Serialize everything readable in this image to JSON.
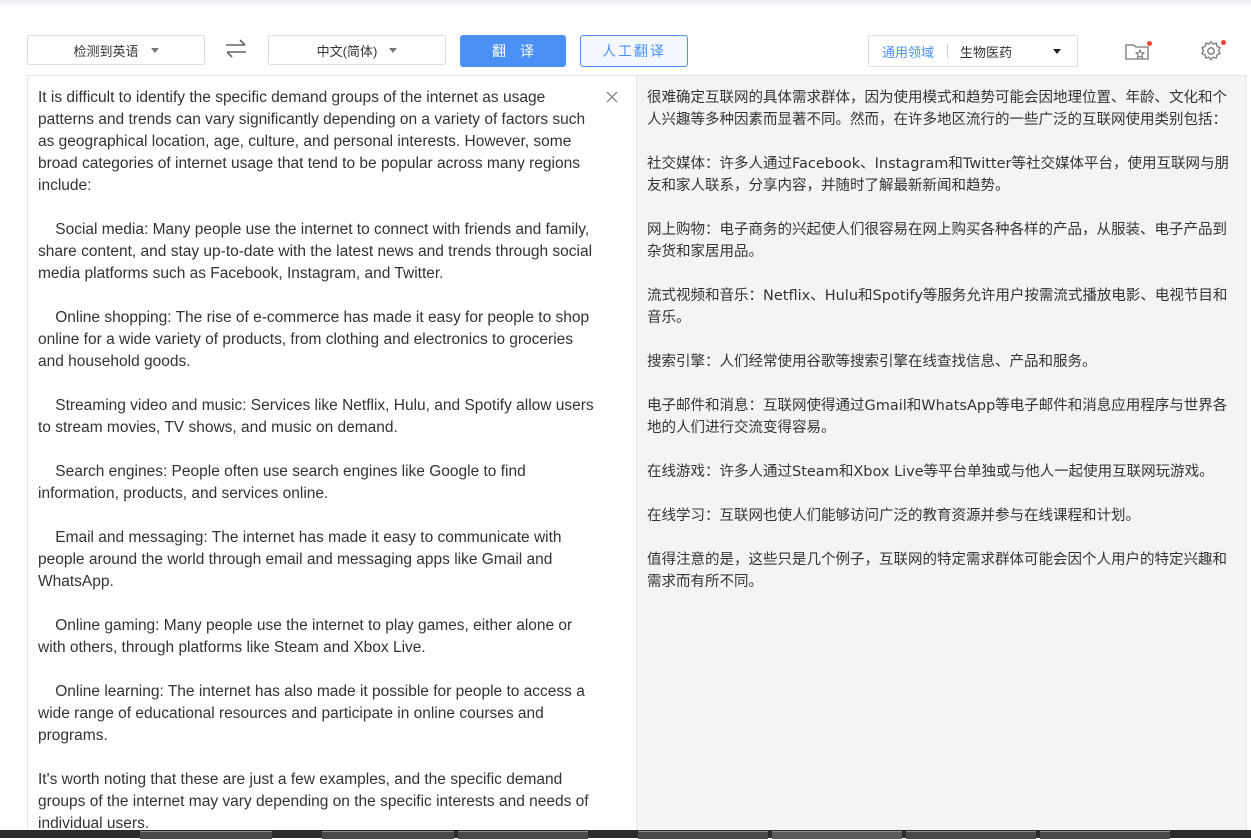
{
  "toolbar": {
    "source_language": "检测到英语",
    "target_language": "中文(简体)",
    "translate_label": "翻译",
    "human_translate_label": "人工翻译",
    "domain_general": "通用领域",
    "domain_current": "生物医药",
    "icons": {
      "swap": "swap-arrows-icon",
      "favorites": "folder-star-icon",
      "settings": "gear-icon",
      "clear": "close-icon"
    },
    "notification_color": "#f04134",
    "accent_color": "#4a90f5"
  },
  "source": {
    "text": "It is difficult to identify the specific demand groups of the internet as usage patterns and trends can vary significantly depending on a variety of factors such as geographical location, age, culture, and personal interests. However, some broad categories of internet usage that tend to be popular across many regions include:\n\n    Social media: Many people use the internet to connect with friends and family, share content, and stay up-to-date with the latest news and trends through social media platforms such as Facebook, Instagram, and Twitter.\n\n    Online shopping: The rise of e-commerce has made it easy for people to shop online for a wide variety of products, from clothing and electronics to groceries and household goods.\n\n    Streaming video and music: Services like Netflix, Hulu, and Spotify allow users to stream movies, TV shows, and music on demand.\n\n    Search engines: People often use search engines like Google to find information, products, and services online.\n\n    Email and messaging: The internet has made it easy to communicate with people around the world through email and messaging apps like Gmail and WhatsApp.\n\n    Online gaming: Many people use the internet to play games, either alone or with others, through platforms like Steam and Xbox Live.\n\n    Online learning: The internet has also made it possible for people to access a wide range of educational resources and participate in online courses and programs.\n\nIt's worth noting that these are just a few examples, and the specific demand groups of the internet may vary depending on the specific interests and needs of individual users."
  },
  "target": {
    "text": "很难确定互联网的具体需求群体，因为使用模式和趋势可能会因地理位置、年龄、文化和个人兴趣等多种因素而显著不同。然而，在许多地区流行的一些广泛的互联网使用类别包括：\n\n社交媒体：许多人通过Facebook、Instagram和Twitter等社交媒体平台，使用互联网与朋友和家人联系，分享内容，并随时了解最新新闻和趋势。\n\n网上购物：电子商务的兴起使人们很容易在网上购买各种各样的产品，从服装、电子产品到杂货和家居用品。\n\n流式视频和音乐：Netflix、Hulu和Spotify等服务允许用户按需流式播放电影、电视节目和音乐。\n\n搜索引擎：人们经常使用谷歌等搜索引擎在线查找信息、产品和服务。\n\n电子邮件和消息：互联网使得通过Gmail和WhatsApp等电子邮件和消息应用程序与世界各地的人们进行交流变得容易。\n\n在线游戏：许多人通过Steam和Xbox Live等平台单独或与他人一起使用互联网玩游戏。\n\n在线学习：互联网也使人们能够访问广泛的教育资源并参与在线课程和计划。\n\n值得注意的是，这些只是几个例子，互联网的特定需求群体可能会因个人用户的特定兴趣和需求而有所不同。"
  }
}
